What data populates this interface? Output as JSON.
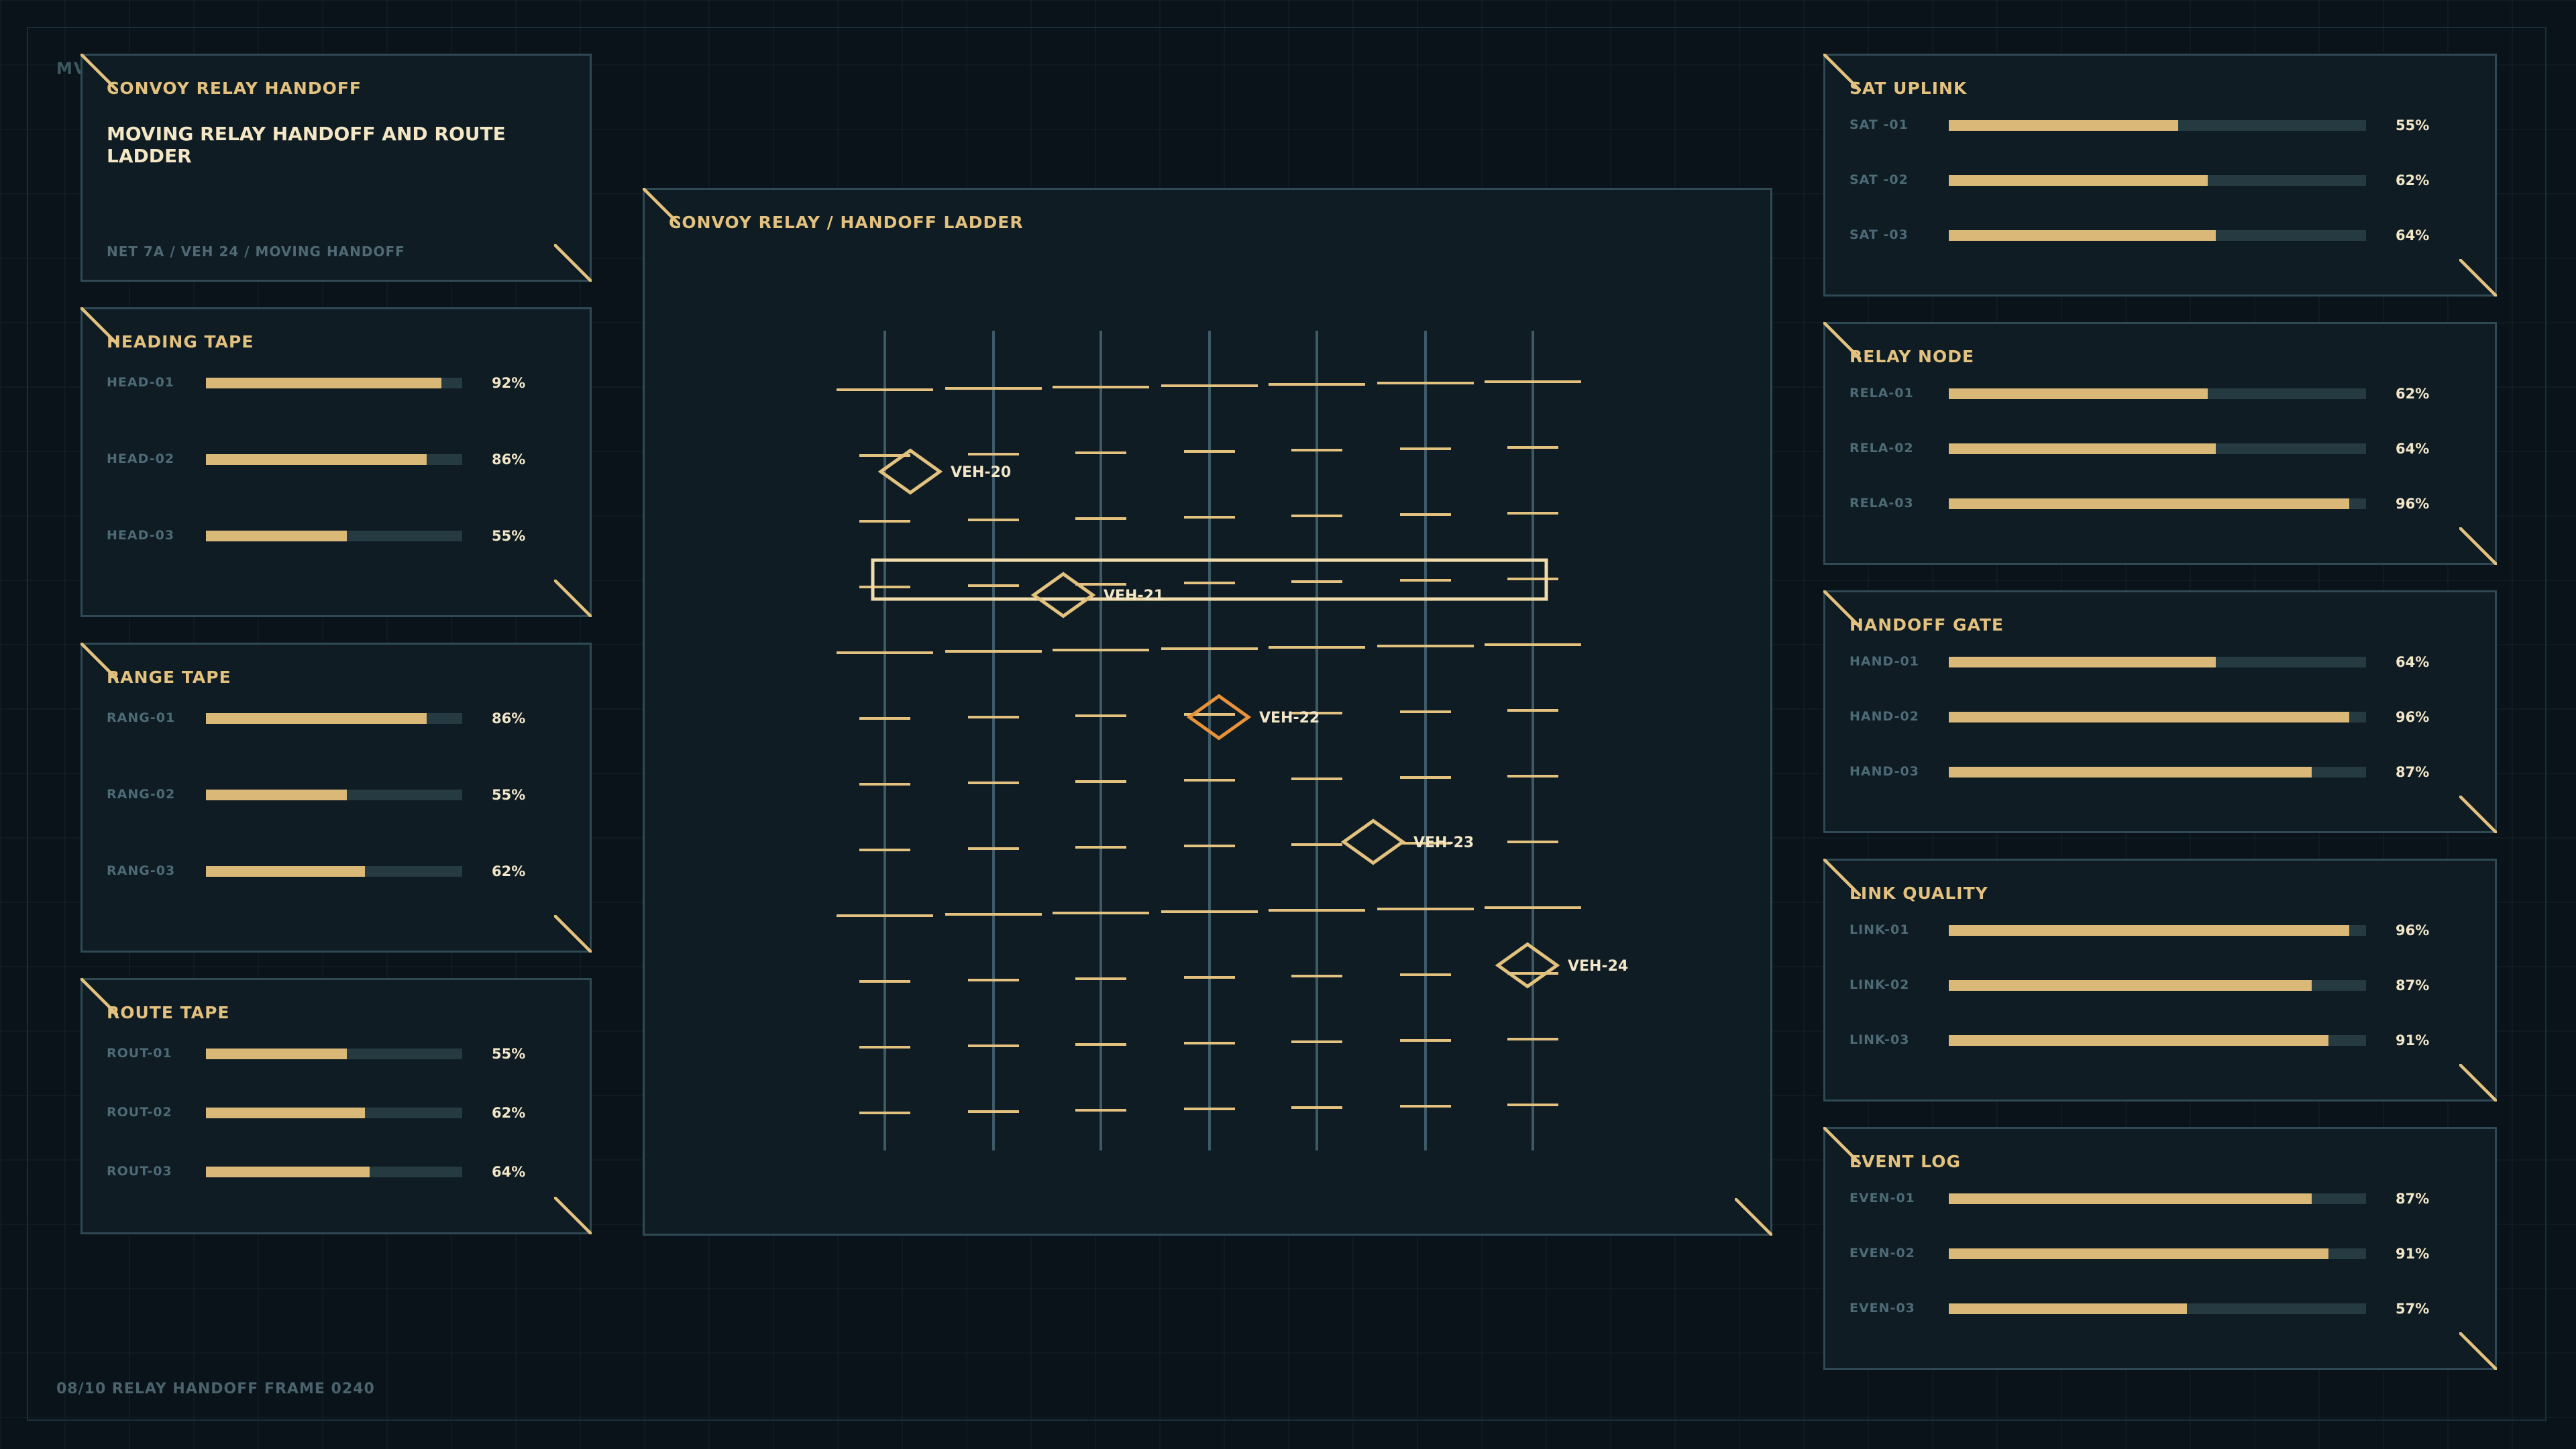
{
  "corner_tag": "MV",
  "header": {
    "title": "CONVOY RELAY HANDOFF",
    "subtitle": "MOVING RELAY HANDOFF AND ROUTE LADDER",
    "footer": "NET 7A / VEH 24 / MOVING HANDOFF"
  },
  "left_panels": [
    {
      "title": "HEADING TAPE",
      "rows": [
        {
          "label": "HEAD-01",
          "value": 92,
          "pct": "92%"
        },
        {
          "label": "HEAD-02",
          "value": 86,
          "pct": "86%"
        },
        {
          "label": "HEAD-03",
          "value": 55,
          "pct": "55%"
        }
      ]
    },
    {
      "title": "RANGE TAPE",
      "rows": [
        {
          "label": "RANG-01",
          "value": 86,
          "pct": "86%"
        },
        {
          "label": "RANG-02",
          "value": 55,
          "pct": "55%"
        },
        {
          "label": "RANG-03",
          "value": 62,
          "pct": "62%"
        }
      ]
    },
    {
      "title": "ROUTE TAPE",
      "rows": [
        {
          "label": "ROUT-01",
          "value": 55,
          "pct": "55%"
        },
        {
          "label": "ROUT-02",
          "value": 62,
          "pct": "62%"
        },
        {
          "label": "ROUT-03",
          "value": 64,
          "pct": "64%"
        }
      ]
    }
  ],
  "center": {
    "title": "CONVOY RELAY / HANDOFF LADDER",
    "vehicles": [
      {
        "id": "VEH-20",
        "label": "VEH-20",
        "status": "normal"
      },
      {
        "id": "VEH-21",
        "label": "VEH-21",
        "status": "normal"
      },
      {
        "id": "VEH-22",
        "label": "VEH-22",
        "status": "active"
      },
      {
        "id": "VEH-23",
        "label": "VEH-23",
        "status": "normal"
      },
      {
        "id": "VEH-24",
        "label": "VEH-24",
        "status": "normal"
      }
    ],
    "accent_color": "#e3c17f",
    "active_color": "#e8923a"
  },
  "right_panels": [
    {
      "title": "SAT UPLINK",
      "rows": [
        {
          "label": "SAT -01",
          "value": 55,
          "pct": "55%"
        },
        {
          "label": "SAT -02",
          "value": 62,
          "pct": "62%"
        },
        {
          "label": "SAT -03",
          "value": 64,
          "pct": "64%"
        }
      ]
    },
    {
      "title": "RELAY NODE",
      "rows": [
        {
          "label": "RELA-01",
          "value": 62,
          "pct": "62%"
        },
        {
          "label": "RELA-02",
          "value": 64,
          "pct": "64%"
        },
        {
          "label": "RELA-03",
          "value": 96,
          "pct": "96%"
        }
      ]
    },
    {
      "title": "HANDOFF GATE",
      "rows": [
        {
          "label": "HAND-01",
          "value": 64,
          "pct": "64%"
        },
        {
          "label": "HAND-02",
          "value": 96,
          "pct": "96%"
        },
        {
          "label": "HAND-03",
          "value": 87,
          "pct": "87%"
        }
      ]
    },
    {
      "title": "LINK QUALITY",
      "rows": [
        {
          "label": "LINK-01",
          "value": 96,
          "pct": "96%"
        },
        {
          "label": "LINK-02",
          "value": 87,
          "pct": "87%"
        },
        {
          "label": "LINK-03",
          "value": 91,
          "pct": "91%"
        }
      ]
    },
    {
      "title": "EVENT LOG",
      "rows": [
        {
          "label": "EVEN-01",
          "value": 87,
          "pct": "87%"
        },
        {
          "label": "EVEN-02",
          "value": 91,
          "pct": "91%"
        },
        {
          "label": "EVEN-03",
          "value": 57,
          "pct": "57%"
        }
      ]
    }
  ],
  "status": "08/10  RELAY HANDOFF  FRAME 0240",
  "colors": {
    "accent": "#e3c17f",
    "bar": "#d9b878",
    "track": "#263a42",
    "border": "#2f4a55",
    "panel": "#0f1c24",
    "background": "#0a131a",
    "active": "#e8923a"
  }
}
